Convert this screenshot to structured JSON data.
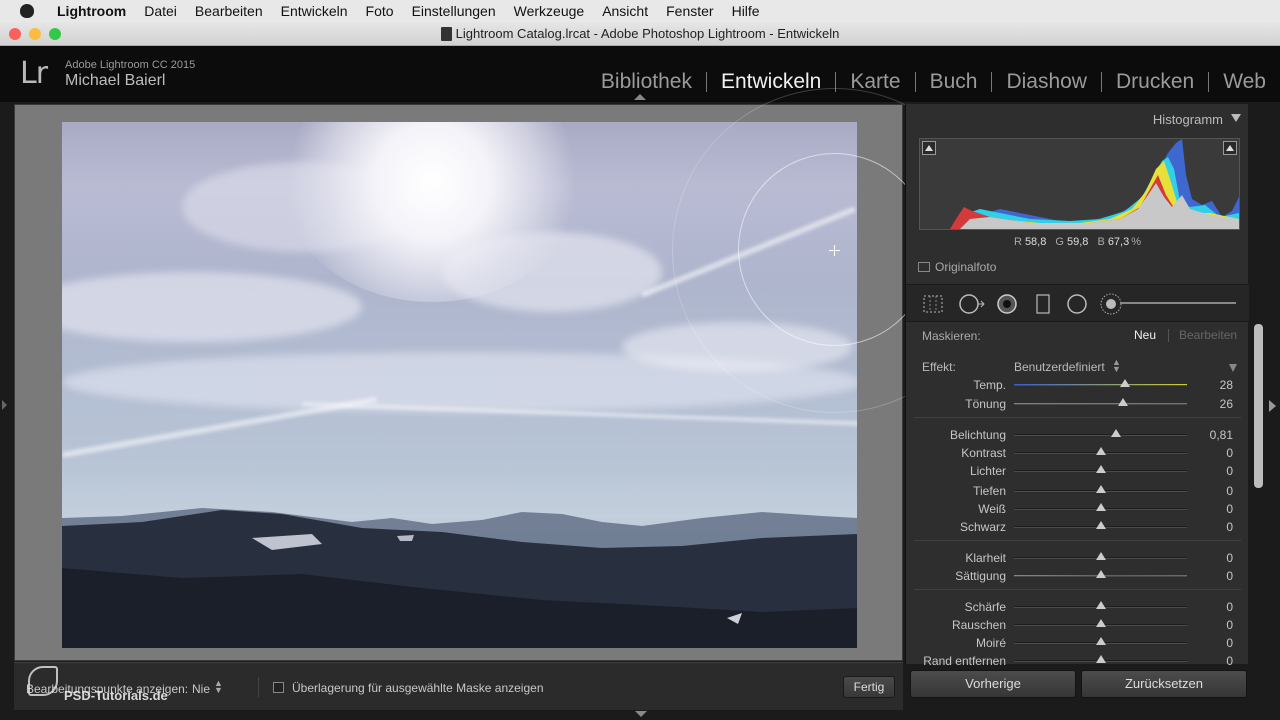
{
  "menubar": {
    "items": [
      "Lightroom",
      "Datei",
      "Bearbeiten",
      "Entwickeln",
      "Foto",
      "Einstellungen",
      "Werkzeuge",
      "Ansicht",
      "Fenster",
      "Hilfe"
    ]
  },
  "window": {
    "title": "Lightroom Catalog.lrcat - Adobe Photoshop Lightroom - Entwickeln"
  },
  "identity": {
    "logo": "Lr",
    "product": "Adobe Lightroom CC 2015",
    "user": "Michael Baierl"
  },
  "modules": [
    "Bibliothek",
    "Entwickeln",
    "Karte",
    "Buch",
    "Diashow",
    "Drucken",
    "Web"
  ],
  "active_module": "Entwickeln",
  "histogram": {
    "title": "Histogramm",
    "r_label": "R",
    "r_value": "58,8",
    "g_label": "G",
    "g_value": "59,8",
    "b_label": "B",
    "b_value": "67,3",
    "unit": "%",
    "original_label": "Originalfoto"
  },
  "mask": {
    "label": "Maskieren:",
    "new": "Neu",
    "edit": "Bearbeiten"
  },
  "effect": {
    "label": "Effekt:",
    "value": "Benutzerdefiniert"
  },
  "sliders": [
    {
      "label": "Temp.",
      "value": "28",
      "position": 0.64
    },
    {
      "label": "Tönung",
      "value": "26",
      "position": 0.63
    },
    {
      "label": "Belichtung",
      "value": "0,81",
      "position": 0.59
    },
    {
      "label": "Kontrast",
      "value": "0",
      "position": 0.5
    },
    {
      "label": "Lichter",
      "value": "0",
      "position": 0.5
    },
    {
      "label": "Tiefen",
      "value": "0",
      "position": 0.5
    },
    {
      "label": "Weiß",
      "value": "0",
      "position": 0.5
    },
    {
      "label": "Schwarz",
      "value": "0",
      "position": 0.5
    },
    {
      "label": "Klarheit",
      "value": "0",
      "position": 0.5
    },
    {
      "label": "Sättigung",
      "value": "0",
      "position": 0.5
    },
    {
      "label": "Schärfe",
      "value": "0",
      "position": 0.5
    },
    {
      "label": "Rauschen",
      "value": "0",
      "position": 0.5
    },
    {
      "label": "Moiré",
      "value": "0",
      "position": 0.5
    },
    {
      "label": "Rand entfernen",
      "value": "0",
      "position": 0.5
    }
  ],
  "toolbar": {
    "show_points_label": "Bearbeitungspunkte anzeigen:",
    "show_points_value": "Nie",
    "overlay_label": "Überlagerung für ausgewählte Maske anzeigen",
    "done": "Fertig"
  },
  "watermark": {
    "text": "PSD-Tutorials.de"
  },
  "buttons": {
    "previous": "Vorherige",
    "reset": "Zurücksetzen"
  },
  "colors": {
    "temp_track": "#3a5cc9",
    "temp_track_end": "#cfcf3a",
    "tint_track": "#2fb34a",
    "tint_track_end": "#c23ab8"
  }
}
